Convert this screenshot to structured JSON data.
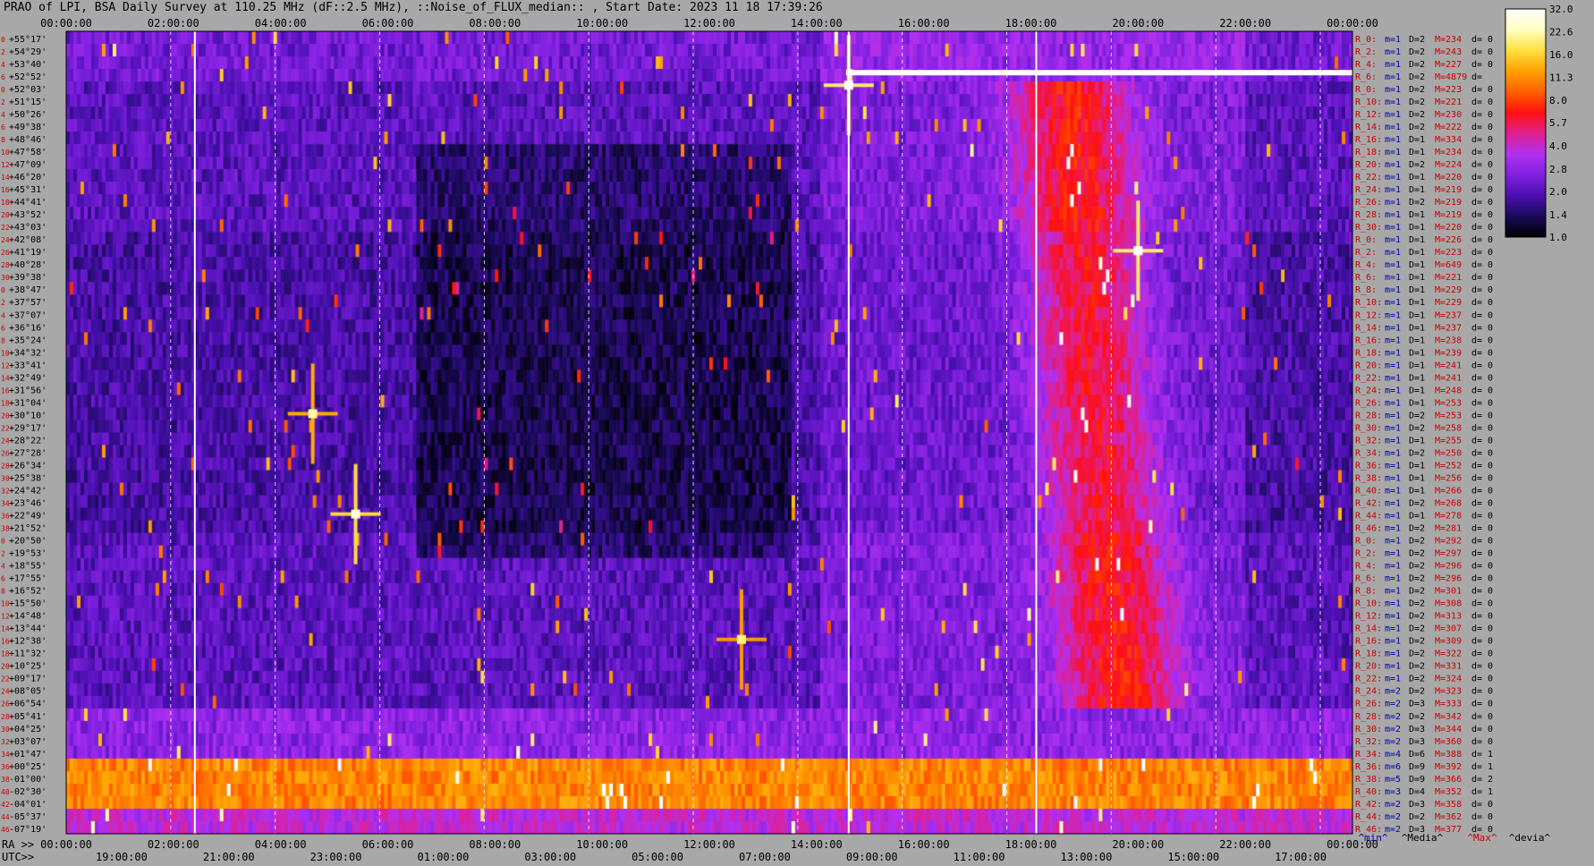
{
  "title": "PRAO of LPI, BSA Daily Survey at 110.25 MHz (dF::2.5 MHz), ::Noise_of_FLUX_median:: , Start Date: 2023 11 18 17:39:26",
  "chart_data": {
    "type": "heatmap",
    "x_top_ticks": [
      "00:00:00",
      "02:00:00",
      "04:00:00",
      "06:00:00",
      "08:00:00",
      "10:00:00",
      "12:00:00",
      "14:00:00",
      "16:00:00",
      "18:00:00",
      "20:00:00",
      "22:00:00",
      "00:00:00"
    ],
    "x_bottom_ra_prefix": "RA >>",
    "x_bottom_ra_ticks": [
      "00:00:00",
      "02:00:00",
      "04:00:00",
      "06:00:00",
      "08:00:00",
      "10:00:00",
      "12:00:00",
      "14:00:00",
      "16:00:00",
      "18:00:00",
      "20:00:00",
      "22:00:00",
      "00:00:00"
    ],
    "x_bottom_utc_prefix": "UTC>>",
    "x_bottom_utc_ticks": [
      "19:00:00",
      "21:00:00",
      "23:00:00",
      "01:00:00",
      "03:00:00",
      "05:00:00",
      "07:00:00",
      "09:00:00",
      "11:00:00",
      "13:00:00",
      "15:00:00",
      "17:00:00"
    ],
    "y_ticks": [
      {
        "row": "0",
        "dec": "+55°17'"
      },
      {
        "row": "2",
        "dec": "+54°29'"
      },
      {
        "row": "4",
        "dec": "+53°40'"
      },
      {
        "row": "6",
        "dec": "+52°52'"
      },
      {
        "row": "0",
        "dec": "+52°03'"
      },
      {
        "row": "2",
        "dec": "+51°15'"
      },
      {
        "row": "4",
        "dec": "+50°26'"
      },
      {
        "row": "6",
        "dec": "+49°38'"
      },
      {
        "row": "8",
        "dec": "+48°46'"
      },
      {
        "row": "10",
        "dec": "+47°58'"
      },
      {
        "row": "12",
        "dec": "+47°09'"
      },
      {
        "row": "14",
        "dec": "+46°20'"
      },
      {
        "row": "16",
        "dec": "+45°31'"
      },
      {
        "row": "18",
        "dec": "+44°41'"
      },
      {
        "row": "20",
        "dec": "+43°52'"
      },
      {
        "row": "22",
        "dec": "+43°03'"
      },
      {
        "row": "24",
        "dec": "+42°08'"
      },
      {
        "row": "26",
        "dec": "+41°19'"
      },
      {
        "row": "28",
        "dec": "+40°28'"
      },
      {
        "row": "30",
        "dec": "+39°38'"
      },
      {
        "row": "0",
        "dec": "+38°47'"
      },
      {
        "row": "2",
        "dec": "+37°57'"
      },
      {
        "row": "4",
        "dec": "+37°07'"
      },
      {
        "row": "6",
        "dec": "+36°16'"
      },
      {
        "row": "8",
        "dec": "+35°24'"
      },
      {
        "row": "10",
        "dec": "+34°32'"
      },
      {
        "row": "12",
        "dec": "+33°41'"
      },
      {
        "row": "14",
        "dec": "+32°49'"
      },
      {
        "row": "16",
        "dec": "+31°56'"
      },
      {
        "row": "18",
        "dec": "+31°04'"
      },
      {
        "row": "20",
        "dec": "+30°10'"
      },
      {
        "row": "22",
        "dec": "+29°17'"
      },
      {
        "row": "24",
        "dec": "+28°22'"
      },
      {
        "row": "26",
        "dec": "+27°28'"
      },
      {
        "row": "28",
        "dec": "+26°34'"
      },
      {
        "row": "30",
        "dec": "+25°38'"
      },
      {
        "row": "32",
        "dec": "+24°42'"
      },
      {
        "row": "34",
        "dec": "+23°46'"
      },
      {
        "row": "36",
        "dec": "+22°49'"
      },
      {
        "row": "38",
        "dec": "+21°52'"
      },
      {
        "row": "0",
        "dec": "+20°50'"
      },
      {
        "row": "2",
        "dec": "+19°53'"
      },
      {
        "row": "4",
        "dec": "+18°55'"
      },
      {
        "row": "6",
        "dec": "+17°55'"
      },
      {
        "row": "8",
        "dec": "+16°52'"
      },
      {
        "row": "10",
        "dec": "+15°50'"
      },
      {
        "row": "12",
        "dec": "+14°48'"
      },
      {
        "row": "14",
        "dec": "+13°44'"
      },
      {
        "row": "16",
        "dec": "+12°38'"
      },
      {
        "row": "18",
        "dec": "+11°32'"
      },
      {
        "row": "20",
        "dec": "+10°25'"
      },
      {
        "row": "22",
        "dec": "+09°17'"
      },
      {
        "row": "24",
        "dec": "+08°05'"
      },
      {
        "row": "26",
        "dec": "+06°54'"
      },
      {
        "row": "28",
        "dec": "+05°41'"
      },
      {
        "row": "30",
        "dec": "+04°25'"
      },
      {
        "row": "32",
        "dec": "+03°07'"
      },
      {
        "row": "34",
        "dec": "+01°47'"
      },
      {
        "row": "36",
        "dec": "+00°25'"
      },
      {
        "row": "38",
        "dec": "-01°00'"
      },
      {
        "row": "40",
        "dec": "-02°30'"
      },
      {
        "row": "42",
        "dec": "-04°01'"
      },
      {
        "row": "44",
        "dec": "-05°37'"
      },
      {
        "row": "46",
        "dec": "-07°19'"
      }
    ],
    "stats": [
      [
        "R_0:",
        "m=1",
        "D=2",
        "M=234",
        "d= 0"
      ],
      [
        "R_2:",
        "m=1",
        "D=2",
        "M=243",
        "d= 0"
      ],
      [
        "R_4:",
        "m=1",
        "D=2",
        "M=227",
        "d= 0"
      ],
      [
        "R_6:",
        "m=1",
        "D=2",
        "M=4879",
        "d="
      ],
      [
        "R_0:",
        "m=1",
        "D=2",
        "M=223",
        "d= 0"
      ],
      [
        "R_10:",
        "m=1",
        "D=2",
        "M=221",
        "d= 0"
      ],
      [
        "R_12:",
        "m=1",
        "D=2",
        "M=230",
        "d= 0"
      ],
      [
        "R_14:",
        "m=1",
        "D=2",
        "M=222",
        "d= 0"
      ],
      [
        "R_16:",
        "m=1",
        "D=1",
        "M=334",
        "d= 0"
      ],
      [
        "R_18:",
        "m=1",
        "D=1",
        "M=234",
        "d= 0"
      ],
      [
        "R_20:",
        "m=1",
        "D=2",
        "M=224",
        "d= 0"
      ],
      [
        "R_22:",
        "m=1",
        "D=1",
        "M=220",
        "d= 0"
      ],
      [
        "R_24:",
        "m=1",
        "D=1",
        "M=219",
        "d= 0"
      ],
      [
        "R_26:",
        "m=1",
        "D=2",
        "M=219",
        "d= 0"
      ],
      [
        "R_28:",
        "m=1",
        "D=1",
        "M=219",
        "d= 0"
      ],
      [
        "R_30:",
        "m=1",
        "D=1",
        "M=220",
        "d= 0"
      ],
      [
        "R_0:",
        "m=1",
        "D=1",
        "M=226",
        "d= 0"
      ],
      [
        "R_2:",
        "m=1",
        "D=1",
        "M=223",
        "d= 0"
      ],
      [
        "R_4:",
        "m=1",
        "D=1",
        "M=649",
        "d= 0"
      ],
      [
        "R_6:",
        "m=1",
        "D=1",
        "M=221",
        "d= 0"
      ],
      [
        "R_8:",
        "m=1",
        "D=1",
        "M=229",
        "d= 0"
      ],
      [
        "R_10:",
        "m=1",
        "D=1",
        "M=229",
        "d= 0"
      ],
      [
        "R_12:",
        "m=1",
        "D=1",
        "M=237",
        "d= 0"
      ],
      [
        "R_14:",
        "m=1",
        "D=1",
        "M=237",
        "d= 0"
      ],
      [
        "R_16:",
        "m=1",
        "D=1",
        "M=238",
        "d= 0"
      ],
      [
        "R_18:",
        "m=1",
        "D=1",
        "M=239",
        "d= 0"
      ],
      [
        "R_20:",
        "m=1",
        "D=1",
        "M=241",
        "d= 0"
      ],
      [
        "R_22:",
        "m=1",
        "D=1",
        "M=241",
        "d= 0"
      ],
      [
        "R_24:",
        "m=1",
        "D=1",
        "M=248",
        "d= 0"
      ],
      [
        "R_26:",
        "m=1",
        "D=1",
        "M=253",
        "d= 0"
      ],
      [
        "R_28:",
        "m=1",
        "D=2",
        "M=253",
        "d= 0"
      ],
      [
        "R_30:",
        "m=1",
        "D=2",
        "M=258",
        "d= 0"
      ],
      [
        "R_32:",
        "m=1",
        "D=1",
        "M=255",
        "d= 0"
      ],
      [
        "R_34:",
        "m=1",
        "D=2",
        "M=250",
        "d= 0"
      ],
      [
        "R_36:",
        "m=1",
        "D=1",
        "M=252",
        "d= 0"
      ],
      [
        "R_38:",
        "m=1",
        "D=1",
        "M=256",
        "d= 0"
      ],
      [
        "R_40:",
        "m=1",
        "D=1",
        "M=266",
        "d= 0"
      ],
      [
        "R_42:",
        "m=1",
        "D=2",
        "M=268",
        "d= 0"
      ],
      [
        "R_44:",
        "m=1",
        "D=1",
        "M=278",
        "d= 0"
      ],
      [
        "R_46:",
        "m=1",
        "D=2",
        "M=281",
        "d= 0"
      ],
      [
        "R_0:",
        "m=1",
        "D=2",
        "M=292",
        "d= 0"
      ],
      [
        "R_2:",
        "m=1",
        "D=2",
        "M=297",
        "d= 0"
      ],
      [
        "R_4:",
        "m=1",
        "D=2",
        "M=296",
        "d= 0"
      ],
      [
        "R_6:",
        "m=1",
        "D=2",
        "M=296",
        "d= 0"
      ],
      [
        "R_8:",
        "m=1",
        "D=2",
        "M=301",
        "d= 0"
      ],
      [
        "R_10:",
        "m=1",
        "D=2",
        "M=308",
        "d= 0"
      ],
      [
        "R_12:",
        "m=1",
        "D=2",
        "M=313",
        "d= 0"
      ],
      [
        "R_14:",
        "m=1",
        "D=2",
        "M=307",
        "d= 0"
      ],
      [
        "R_16:",
        "m=1",
        "D=2",
        "M=309",
        "d= 0"
      ],
      [
        "R_18:",
        "m=1",
        "D=2",
        "M=322",
        "d= 0"
      ],
      [
        "R_20:",
        "m=1",
        "D=2",
        "M=331",
        "d= 0"
      ],
      [
        "R_22:",
        "m=1",
        "D=2",
        "M=324",
        "d= 0"
      ],
      [
        "R_24:",
        "m=2",
        "D=2",
        "M=323",
        "d= 0"
      ],
      [
        "R_26:",
        "m=2",
        "D=3",
        "M=333",
        "d= 0"
      ],
      [
        "R_28:",
        "m=2",
        "D=2",
        "M=342",
        "d= 0"
      ],
      [
        "R_30:",
        "m=2",
        "D=3",
        "M=344",
        "d= 0"
      ],
      [
        "R_32:",
        "m=2",
        "D=3",
        "M=360",
        "d= 0"
      ],
      [
        "R_34:",
        "m=4",
        "D=6",
        "M=388",
        "d= 1"
      ],
      [
        "R_36:",
        "m=6",
        "D=9",
        "M=392",
        "d= 1"
      ],
      [
        "R_38:",
        "m=5",
        "D=9",
        "M=366",
        "d= 2"
      ],
      [
        "R_40:",
        "m=3",
        "D=4",
        "M=352",
        "d= 1"
      ],
      [
        "R_42:",
        "m=2",
        "D=3",
        "M=358",
        "d= 0"
      ],
      [
        "R_44:",
        "m=2",
        "D=2",
        "M=362",
        "d= 0"
      ],
      [
        "R_46:",
        "m=2",
        "D=3",
        "M=377",
        "d= 0"
      ]
    ],
    "stats_footer": [
      "^min^",
      "^Media^",
      "^Max^",
      "^devia^"
    ],
    "colorbar": {
      "ticks": [
        "32.0",
        "22.6",
        "16.0",
        "11.3",
        "8.0",
        "5.7",
        "4.0",
        "2.8",
        "2.0",
        "1.4",
        "1.0"
      ],
      "range": [
        1.0,
        32.0
      ],
      "scale": "log",
      "colormap": [
        "#000000",
        "#1a0a5a",
        "#4a10b0",
        "#8020e0",
        "#b030f0",
        "#e02090",
        "#ff1010",
        "#ff6000",
        "#ffa000",
        "#ffe040",
        "#ffffc0",
        "#ffffff"
      ]
    },
    "time_range_hours": [
      0,
      24
    ],
    "bands": [
      {
        "rows": [
          0,
          3
        ],
        "level": 2.2
      },
      {
        "rows": [
          4,
          15
        ],
        "level": 1.9
      },
      {
        "rows": [
          16,
          39
        ],
        "level": 1.7
      },
      {
        "rows": [
          40,
          53
        ],
        "level": 1.9
      },
      {
        "rows": [
          54,
          57
        ],
        "level": 2.6
      },
      {
        "rows": [
          58,
          61
        ],
        "level": 10.0
      },
      {
        "rows": [
          62,
          63
        ],
        "level": 3.5
      }
    ],
    "bright_sources": [
      {
        "t": 20.0,
        "row": 17.5,
        "level": 32
      },
      {
        "t": 5.4,
        "row": 38.5,
        "level": 28
      },
      {
        "t": 12.6,
        "row": 48.5,
        "level": 20
      },
      {
        "t": 4.6,
        "row": 30.5,
        "level": 22
      },
      {
        "t": 14.6,
        "row": 4.3,
        "level": 32
      }
    ],
    "saturated_track": {
      "row": 3.3,
      "t_start": 14.55,
      "t_end": 24.0
    },
    "solid_lines_hours": [
      2.4,
      14.6,
      18.1
    ],
    "dashed_lines_hours": [
      1.95,
      3.9,
      5.85,
      7.8,
      9.75,
      11.7,
      13.65,
      15.6,
      17.55,
      19.5,
      21.45,
      23.4
    ]
  }
}
